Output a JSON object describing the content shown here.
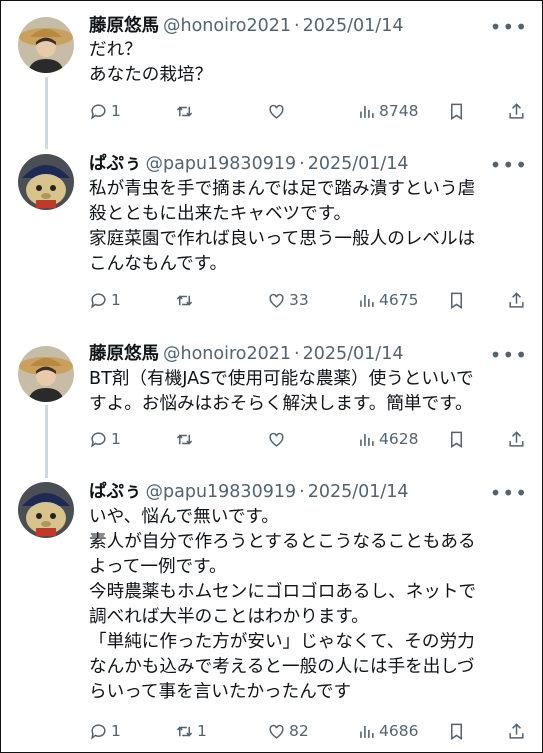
{
  "tweets": [
    {
      "author": "藤原悠馬",
      "handle": "@honoiro2021",
      "date": "2025/01/14",
      "text": "だれ？\nあなたの栽培？",
      "replies": "1",
      "retweets": "",
      "likes": "",
      "views": "8748"
    },
    {
      "author": "ぱぷぅ",
      "handle": "@papu19830919",
      "date": "2025/01/14",
      "text": "私が青虫を手で摘まんでは足で踏み潰すという虐\n殺とともに出来たキャベツです。\n家庭菜園で作れば良いって思う一般人のレベルは\nこんなもんです。",
      "replies": "1",
      "retweets": "",
      "likes": "33",
      "views": "4675"
    },
    {
      "author": "藤原悠馬",
      "handle": "@honoiro2021",
      "date": "2025/01/14",
      "text": "BT剤（有機JASで使用可能な農薬）使うといいで\nすよ。お悩みはおそらく解決します。簡単です。",
      "replies": "1",
      "retweets": "",
      "likes": "",
      "views": "4628"
    },
    {
      "author": "ぱぷぅ",
      "handle": "@papu19830919",
      "date": "2025/01/14",
      "text": "いや、悩んで無いです。\n素人が自分で作ろうとするとこうなることもある\nよって一例です。\n今時農薬もホムセンにゴロゴロあるし、ネットで\n調べれば大半のことはわかります。\n「単純に作った方が安い」じゃなくて、その労力\nなんかも込みで考えると一般の人には手を出しづ\nらいって事を言いたかったんです",
      "replies": "1",
      "retweets": "1",
      "likes": "82",
      "views": "4686"
    }
  ],
  "separator": "·",
  "more_icon": "•••",
  "icons": [
    "reply-icon",
    "retweet-icon",
    "like-icon",
    "views-icon",
    "bookmark-icon",
    "share-icon"
  ]
}
